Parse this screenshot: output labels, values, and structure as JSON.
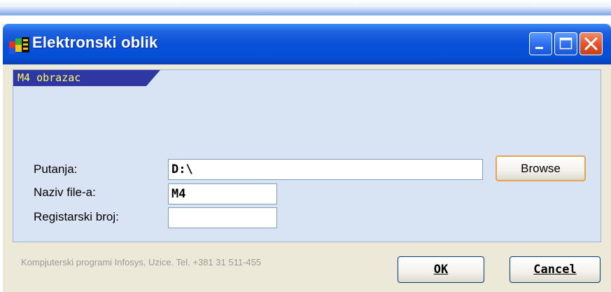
{
  "window": {
    "title": "Elektronski oblik",
    "minimize_icon": "minimize-icon",
    "maximize_icon": "maximize-icon",
    "close_icon": "close-icon"
  },
  "panel": {
    "tab_label": "M4 obrazac"
  },
  "form": {
    "putanja_label": "Putanja:",
    "putanja_value": "D:\\",
    "browse_label": "Browse",
    "naziv_label": "Naziv file-a:",
    "naziv_value": "M4",
    "registarski_label": "Registarski broj:",
    "registarski_value": ""
  },
  "footer": {
    "credits": "Kompjuterski programi Infosys, Uzice. Tel. +381 31 511-455",
    "ok_label": "OK",
    "cancel_label": "Cancel"
  },
  "colors": {
    "titlebar": "#0a4fd8",
    "panel_bg": "#d8e3f3",
    "tab_bg": "#2f37a5",
    "tab_text": "#ffff5a",
    "browse_border": "#e8a44d"
  }
}
